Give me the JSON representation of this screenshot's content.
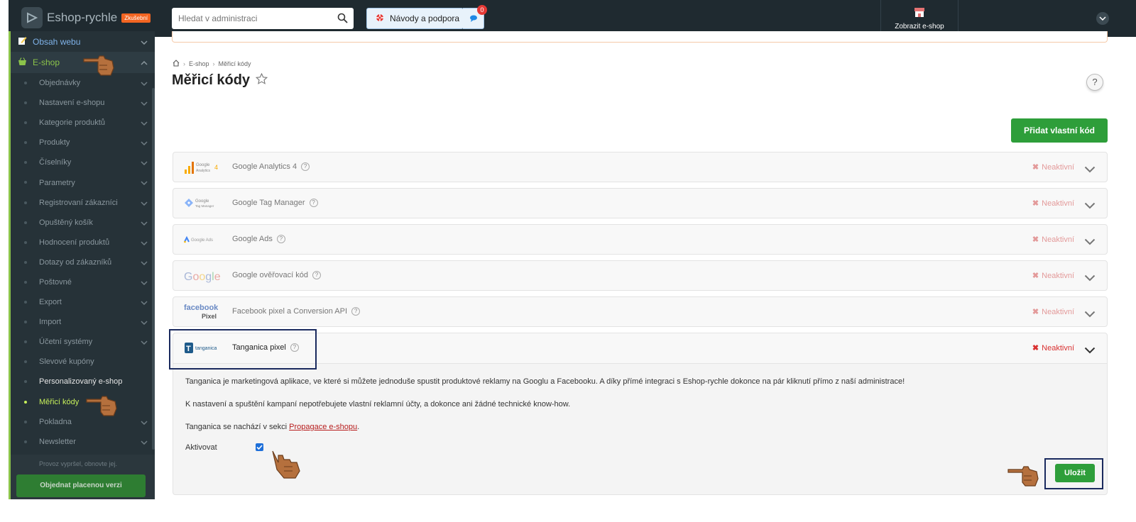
{
  "topbar": {
    "logo_text": "Eshop-rychle",
    "logo_badge": "Zkušební",
    "search_placeholder": "Hledat v administraci",
    "help_label": "Návody a podpora",
    "chat_count": "0",
    "show_shop_label": "Zobrazit e-shop"
  },
  "sidebar": {
    "top_item": "Obsah webu",
    "section": "E-shop",
    "items": [
      {
        "label": "Objednávky",
        "state": "normal"
      },
      {
        "label": "Nastavení e-shopu",
        "state": "normal"
      },
      {
        "label": "Kategorie produktů",
        "state": "normal"
      },
      {
        "label": "Produkty",
        "state": "normal"
      },
      {
        "label": "Číselníky",
        "state": "normal"
      },
      {
        "label": "Parametry",
        "state": "normal"
      },
      {
        "label": "Registrovaní zákazníci",
        "state": "normal"
      },
      {
        "label": "Opuštěný košík",
        "state": "normal"
      },
      {
        "label": "Hodnocení produktů",
        "state": "normal"
      },
      {
        "label": "Dotazy od zákazníků",
        "state": "normal"
      },
      {
        "label": "Poštovné",
        "state": "normal"
      },
      {
        "label": "Export",
        "state": "normal"
      },
      {
        "label": "Import",
        "state": "normal"
      },
      {
        "label": "Účetní systémy",
        "state": "normal"
      },
      {
        "label": "Slevové kupóny",
        "state": "normal"
      },
      {
        "label": "Personalizovaný e-shop",
        "state": "white"
      },
      {
        "label": "Měřicí kódy",
        "state": "active"
      },
      {
        "label": "Pokladna",
        "state": "normal"
      },
      {
        "label": "Newsletter",
        "state": "normal"
      }
    ],
    "expired_text": "Provoz vypršel, obnovte jej.",
    "order_button": "Objednat placenou verzi"
  },
  "breadcrumb": [
    "E-shop",
    "Měřicí kódy"
  ],
  "page_title": "Měřicí kódy",
  "help_symbol": "?",
  "add_button": "Přidat vlastní kód",
  "status_label": "Neaktivní",
  "panels": [
    {
      "name": "Google Analytics 4",
      "logo": "Google Analytics 4"
    },
    {
      "name": "Google Tag Manager",
      "logo": "Google Tag Manager"
    },
    {
      "name": "Google Ads",
      "logo": "Google Ads"
    },
    {
      "name": "Google ověřovací kód",
      "logo": "Google"
    },
    {
      "name": "Facebook pixel a Conversion API",
      "logo": "facebook Pixel"
    }
  ],
  "tanganica": {
    "name": "Tanganica pixel",
    "logo": "tanganica",
    "para1": "Tanganica je marketingová aplikace, ve které si můžete jednoduše spustit produktové reklamy na Googlu a Facebooku. A díky přímé integraci s Eshop-rychle dokonce na pár kliknutí přímo z naší administrace!",
    "para2": "K nastavení a spuštění kampaní nepotřebujete vlastní reklamní účty, a dokonce ani žádné technické know-how.",
    "para3_prefix": "Tanganica se nachází v sekci ",
    "para3_link": "Propagace e-shopu",
    "para3_suffix": ".",
    "activate_label": "Aktivovat",
    "activate_checked": true,
    "save_button": "Uložit"
  },
  "colors": {
    "sidebar_bg": "#263238",
    "accent_green": "#2e9e3a",
    "active_nav": "#c6ef5a",
    "inactive_red": "#d93030",
    "highlight_box": "#1a2a5e"
  }
}
